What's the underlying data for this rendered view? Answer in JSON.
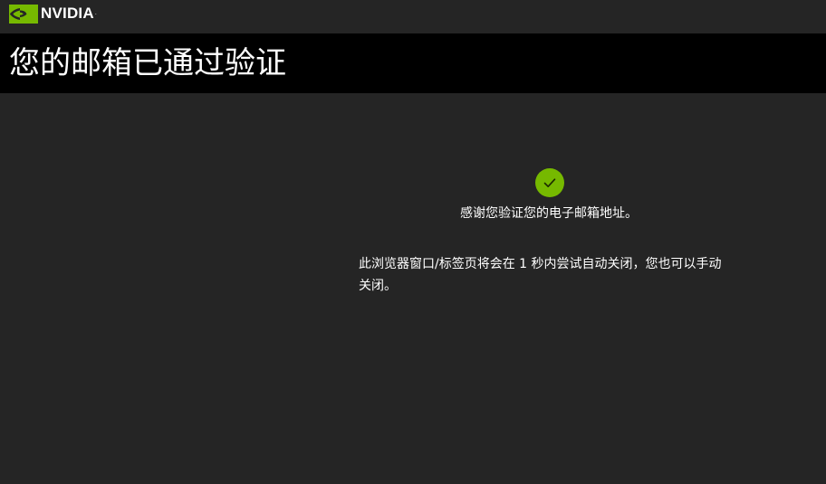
{
  "brand": {
    "logo_text": "NVIDIA",
    "logo_mark": ".",
    "accent_color": "#76b900"
  },
  "header": {
    "title": "您的邮箱已通过验证"
  },
  "main": {
    "status_icon": "check-icon",
    "thanks_message": "感谢您验证您的电子邮箱地址。",
    "close_message": "此浏览器窗口/标签页将会在 1 秒内尝试自动关闭，您也可以手动关闭。"
  },
  "colors": {
    "background": "#252525",
    "title_bar": "#000000",
    "text": "#ffffff"
  }
}
